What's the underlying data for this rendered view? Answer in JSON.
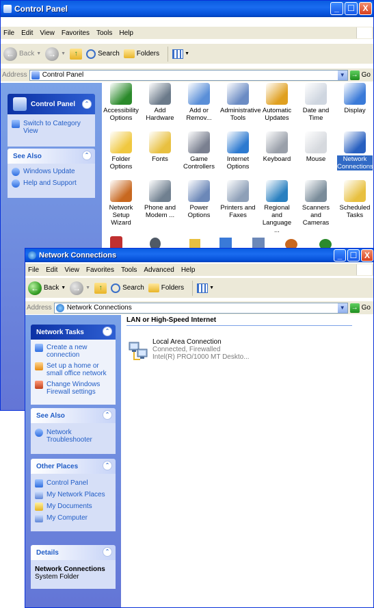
{
  "control_panel": {
    "title": "Control Panel",
    "menu": [
      "File",
      "Edit",
      "View",
      "Favorites",
      "Tools",
      "Help"
    ],
    "toolbar": {
      "back": "Back",
      "search": "Search",
      "folders": "Folders"
    },
    "address": {
      "label": "Address",
      "value": "Control Panel",
      "go": "Go"
    },
    "side": {
      "panel_title": "Control Panel",
      "switch_view": "Switch to Category View",
      "see_also_title": "See Also",
      "see_also": [
        "Windows Update",
        "Help and Support"
      ]
    },
    "icons": [
      {
        "label": "Accessibility Options",
        "icon": "accessibility-icon",
        "color": "#2b8a2b"
      },
      {
        "label": "Add Hardware",
        "icon": "add-hardware-icon",
        "color": "#6b7a8a"
      },
      {
        "label": "Add or Remov...",
        "icon": "add-remove-programs-icon",
        "color": "#5a8fd8"
      },
      {
        "label": "Administrative Tools",
        "icon": "administrative-tools-icon",
        "color": "#6b8cc4"
      },
      {
        "label": "Automatic Updates",
        "icon": "automatic-updates-icon",
        "color": "#e0a020"
      },
      {
        "label": "Date and Time",
        "icon": "date-time-icon",
        "color": "#cfd6e0"
      },
      {
        "label": "Display",
        "icon": "display-icon",
        "color": "#3a7ad8"
      },
      {
        "label": "Folder Options",
        "icon": "folder-options-icon",
        "color": "#f0c840"
      },
      {
        "label": "Fonts",
        "icon": "fonts-icon",
        "color": "#e8c040"
      },
      {
        "label": "Game Controllers",
        "icon": "game-controllers-icon",
        "color": "#7a8090"
      },
      {
        "label": "Internet Options",
        "icon": "internet-options-icon",
        "color": "#2d7ad0"
      },
      {
        "label": "Keyboard",
        "icon": "keyboard-icon",
        "color": "#9aa0aa"
      },
      {
        "label": "Mouse",
        "icon": "mouse-icon",
        "color": "#d6d9de"
      },
      {
        "label": "Network Connections",
        "icon": "network-connections-icon",
        "color": "#2860c0",
        "selected": true
      },
      {
        "label": "Network Setup Wizard",
        "icon": "network-setup-wizard-icon",
        "color": "#c86820"
      },
      {
        "label": "Phone and Modem ...",
        "icon": "phone-modem-icon",
        "color": "#708090"
      },
      {
        "label": "Power Options",
        "icon": "power-options-icon",
        "color": "#6c88b8"
      },
      {
        "label": "Printers and Faxes",
        "icon": "printers-faxes-icon",
        "color": "#8ea0b8"
      },
      {
        "label": "Regional and Language ...",
        "icon": "regional-language-icon",
        "color": "#2a80c0"
      },
      {
        "label": "Scanners and Cameras",
        "icon": "scanners-cameras-icon",
        "color": "#7a8c9a"
      },
      {
        "label": "Scheduled Tasks",
        "icon": "scheduled-tasks-icon",
        "color": "#e8c040"
      }
    ]
  },
  "network_connections": {
    "title": "Network Connections",
    "menu": [
      "File",
      "Edit",
      "View",
      "Favorites",
      "Tools",
      "Advanced",
      "Help"
    ],
    "toolbar": {
      "back": "Back",
      "search": "Search",
      "folders": "Folders"
    },
    "address": {
      "label": "Address",
      "value": "Network Connections",
      "go": "Go"
    },
    "section_title": "LAN or High-Speed Internet",
    "connection": {
      "name": "Local Area Connection",
      "status": "Connected, Firewalled",
      "device": "Intel(R) PRO/1000 MT Deskto..."
    },
    "side": {
      "network_tasks_title": "Network Tasks",
      "network_tasks": [
        "Create a new connection",
        "Set up a home or small office network",
        "Change Windows Firewall settings"
      ],
      "see_also_title": "See Also",
      "see_also": [
        "Network Troubleshooter"
      ],
      "other_places_title": "Other Places",
      "other_places": [
        "Control Panel",
        "My Network Places",
        "My Documents",
        "My Computer"
      ],
      "details_title": "Details",
      "details_name": "Network Connections",
      "details_type": "System Folder"
    }
  }
}
